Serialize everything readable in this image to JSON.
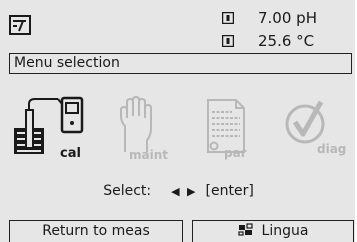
{
  "status": {
    "ph_reading": "7.00 pH",
    "temperature_reading": "25.6 °C"
  },
  "menu": {
    "title": "Menu selection",
    "items": [
      {
        "label": "cal",
        "icon": "calibration-icon",
        "active": true
      },
      {
        "label": "maint",
        "icon": "hand-icon",
        "active": false
      },
      {
        "label": "par",
        "icon": "document-icon",
        "active": false
      },
      {
        "label": "diag",
        "icon": "checkmark-icon",
        "active": false
      }
    ]
  },
  "hint": {
    "prefix": "Select:",
    "arrows": "◀ ▶",
    "key": "[enter]"
  },
  "softkeys": {
    "left": "Return to meas",
    "right": "Lingua"
  },
  "colors": {
    "background": "#e6e6e6",
    "foreground": "#1a1a1a",
    "inactive_icon": "#b8b8b8"
  }
}
